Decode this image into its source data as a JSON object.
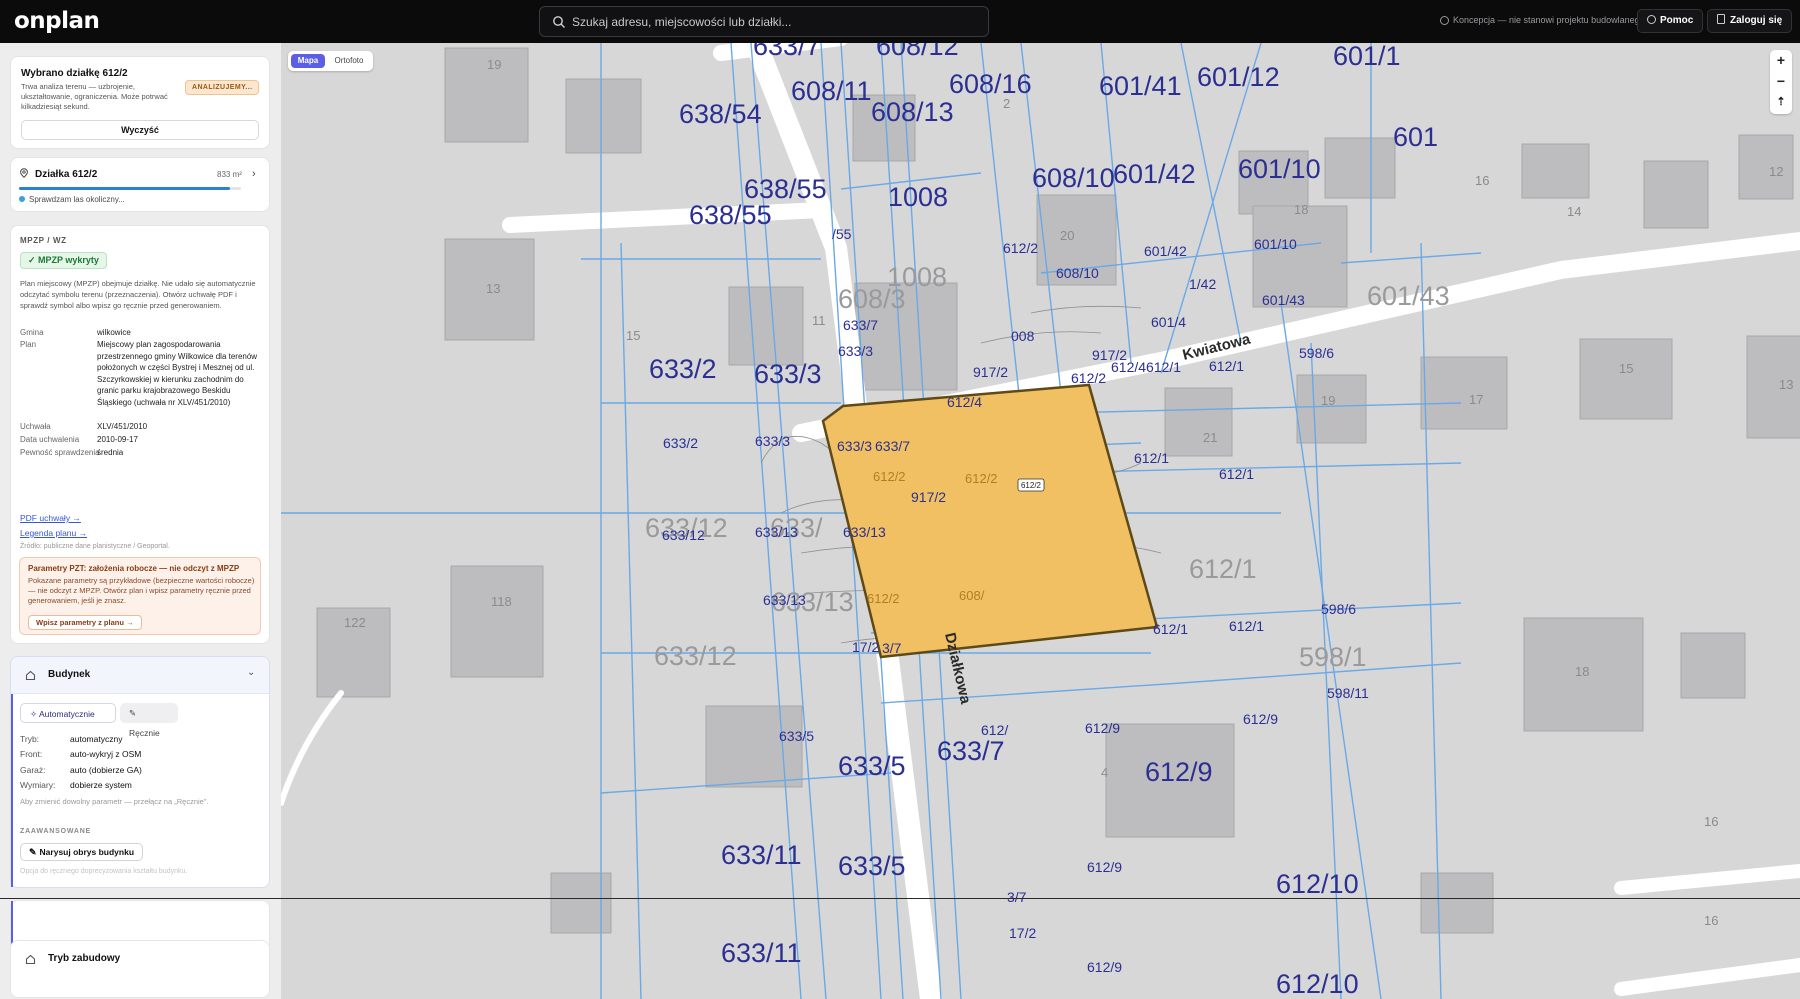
{
  "topbar": {
    "logo": "onplan",
    "search_placeholder": "Szukaj adresu, miejscowości lub działki...",
    "note": "Koncepcja — nie stanowi projektu budowlanego",
    "help": "Pomoc",
    "login": "Zaloguj się"
  },
  "selection": {
    "title": "Wybrano działkę 612/2",
    "desc": "Trwa analiza terenu — uzbrojenie, ukształtowanie, ograniczenia. Może potrwać kilkadziesiąt sekund.",
    "badge": "ANALIZUJEMY...",
    "clear": "Wyczyść"
  },
  "parcel": {
    "label": "Działka 612/2",
    "area": "833 m²",
    "progress": 0.95,
    "status": "Sprawdzam las okoliczny..."
  },
  "mpzp": {
    "heading": "MPZP / WZ",
    "badge": "MPZP wykryty",
    "info": "Plan miejscowy (MPZP) obejmuje działkę. Nie udało się automatycznie odczytać symbolu terenu (przeznaczenia). Otwórz uchwałę PDF i sprawdź symbol albo wpisz go ręcznie przed generowaniem.",
    "rows": [
      {
        "k": "Gmina",
        "v": "wilkowice"
      },
      {
        "k": "Plan",
        "v": "Miejscowy plan zagospodarowania przestrzennego gminy Wilkowice dla terenów położonych w części Bystrej i Mesznej od ul. Szczyrkowskiej w kierunku zachodnim do granic parku krajobrazowego Beskidu Śląskiego (uchwała nr XLV/451/2010)"
      },
      {
        "k": "Uchwała",
        "v": "XLV/451/2010"
      },
      {
        "k": "Data uchwalenia",
        "v": "2010-09-17"
      },
      {
        "k": "Pewność sprawdzenia",
        "v": "średnia"
      }
    ],
    "pdf_link": "PDF uchwały →",
    "legend_link": "Legenda planu →",
    "source": "Źródło: publiczne dane planistyczne / Geoportal.",
    "warn_title": "Parametry PZT: założenia robocze — nie odczyt z MPZP",
    "warn_desc": "Pokazane parametry są przykładowe (bezpieczne wartości robocze) — nie odczyt z MPZP. Otwórz plan i wpisz parametry ręcznie przed generowaniem, jeśli je znasz.",
    "warn_btn": "Wpisz parametry z planu →"
  },
  "building": {
    "title": "Budynek",
    "tab_auto": "Automatycznie",
    "tab_manual": "Ręcznie",
    "rows": [
      {
        "k": "Tryb:",
        "v": "automatyczny"
      },
      {
        "k": "Front:",
        "v": "auto-wykryj z OSM"
      },
      {
        "k": "Garaż:",
        "v": "auto (dobierze GA)"
      },
      {
        "k": "Wymiary:",
        "v": "dobierze system"
      }
    ],
    "hint": "Aby zmienić dowolny parametr — przełącz na „Ręcznie\".",
    "advanced": "ZAAWANSOWANE",
    "draw_btn": "Narysuj obrys budynku",
    "draw_opt": "Opcja do ręcznego doprecyzowania kształtu budynku."
  },
  "mode": {
    "title": "Tryb zabudowy"
  },
  "map": {
    "toggle_map": "Mapa",
    "toggle_ortho": "Ortofoto",
    "zoom_in": "+",
    "zoom_out": "−",
    "reset": "⇡",
    "selected_label": "612/2",
    "street_1": "Kwiatowa",
    "street_2": "Działkowa",
    "parcel_labels_big": [
      "633/7",
      "608/12",
      "601/1",
      "638/54",
      "608/11",
      "608/13",
      "608/16",
      "601/41",
      "601/12",
      "601",
      "638/55",
      "1008",
      "608/10",
      "601/42",
      "601/10",
      "638/55",
      "633/2",
      "633/3",
      "1008",
      "608/3",
      "601/43",
      "612/1",
      "633/12",
      "633/",
      "633/13",
      "633/5",
      "633/11",
      "598/1",
      "612/9",
      "612/10",
      "633/12",
      "633/7",
      "633/5",
      "633/11",
      "612/10"
    ],
    "parcel_labels_small": [
      "/55",
      "633/7",
      "633/3",
      "008",
      "917/2",
      "612/2",
      "612/4",
      "612/4612/1",
      "612/1",
      "601/4",
      "1/42",
      "598/6",
      "601/43",
      "917/2",
      "601/42",
      "608/10",
      "601/10",
      "633/2",
      "633/3",
      "633/3",
      "633/7",
      "917/2",
      "612/1",
      "612/1",
      "633/12",
      "633/13",
      "633/13",
      "633/13",
      "633/5",
      "612/",
      "612/9",
      "612/9",
      "612/9",
      "598/6",
      "598/11",
      "612/1",
      "612/1",
      "3/7",
      "17/2",
      "612/9",
      "3/7",
      "17/2",
      "612/2",
      "612/2",
      "612/2",
      "612/2",
      "608/"
    ],
    "house_numbers": [
      "19",
      "2",
      "16",
      "12",
      "18",
      "14",
      "20",
      "13",
      "11",
      "15",
      "21",
      "19",
      "17",
      "15",
      "13",
      "118",
      "122",
      "4",
      "18",
      "16",
      "16"
    ]
  }
}
